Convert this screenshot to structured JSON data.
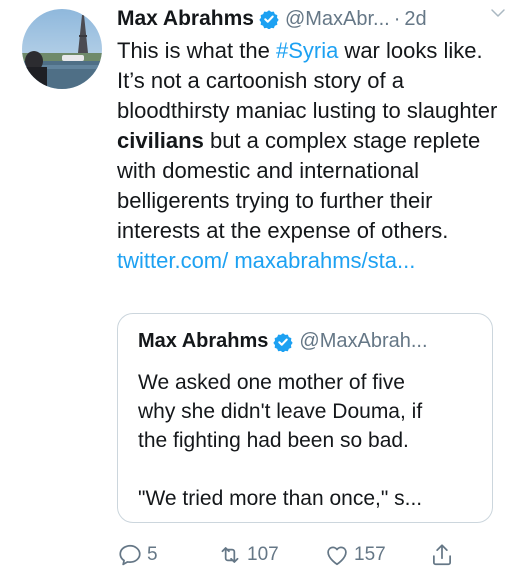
{
  "author": {
    "name": "Max Abrahms",
    "handle": "@MaxAbr...",
    "separator": "·",
    "time": "2d"
  },
  "tweet": {
    "t1": "This is what the ",
    "hashtag": "#Syria",
    "t2": " war looks like. It’s not a cartoonish story of a bloodthirsty maniac lusting to slaughter ",
    "bold": "civilians",
    "t3": " but a complex stage replete with domestic and international belligerents trying to further their interests at the expense of others. ",
    "link": "twitter.com/ maxabrahms/sta..."
  },
  "quoted": {
    "name": "Max Abrahms",
    "handle": "@MaxAbrah...",
    "lines": [
      "We asked one mother of five",
      "why she didn't leave Douma, if",
      "the fighting had been so bad.",
      "\"We tried more than once,\" s..."
    ]
  },
  "actions": {
    "reply_count": "5",
    "retweet_count": "107",
    "like_count": "157"
  },
  "colors": {
    "accent": "#1da1f2",
    "secondary_text": "#657786",
    "border": "#ccd6dd"
  },
  "icons": [
    "verified-icon",
    "chevron-down-icon",
    "reply-icon",
    "retweet-icon",
    "like-icon",
    "share-icon"
  ]
}
